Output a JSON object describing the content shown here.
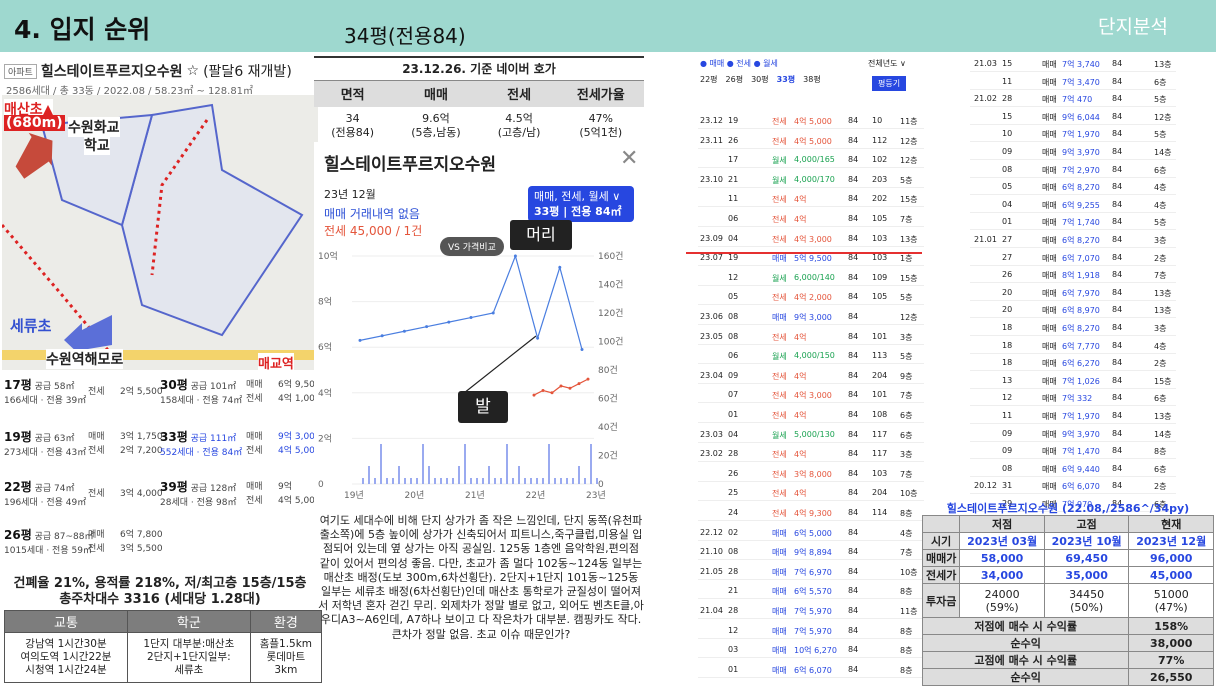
{
  "header": {
    "title": "4. 입지 순위",
    "subtitle": "34평(전용84)",
    "brand": "단지분석"
  },
  "p1": {
    "tag": "아파트",
    "name": "힐스테이트푸르지오수원",
    "star": "☆",
    "note": "(팔달6 재개발)",
    "sub": "2586세대 / 총 33동 / 2022.08 / 58.23㎡ ~ 128.81㎡",
    "map": {
      "maesan": "매산초▲",
      "maesan_dist": "(680m)",
      "school1": "수원화교",
      "school2": "학교",
      "seryu": "세류초",
      "road": "수원역해모로",
      "maegyo": "매교역"
    },
    "listings": [
      {
        "py": "17평",
        "a1": "공급 58㎡",
        "a2": "166세대 · 전용 39㎡",
        "t1": "전세",
        "v1": "2억 5,500"
      },
      {
        "py": "30평",
        "a1": "공급 101㎡",
        "a2": "158세대 · 전용 74㎡",
        "t1": "매매",
        "v1": "6억 9,500",
        "t2": "전세",
        "v2": "4억 1,000"
      },
      {
        "py": "19평",
        "a1": "공급 63㎡",
        "a2": "273세대 · 전용 43㎡",
        "t1": "매매",
        "v1": "3억 1,750",
        "t2": "전세",
        "v2": "2억 7,200"
      },
      {
        "py": "33평",
        "a1": "공급 111㎡",
        "a2": "552세대 · 전용 84㎡",
        "t1": "매매",
        "v1": "9억 3,000",
        "t2": "전세",
        "v2": "4억 5,000"
      },
      {
        "py": "22평",
        "a1": "공급 74㎡",
        "a2": "196세대 · 전용 49㎡",
        "t1": "전세",
        "v1": "3억 4,000"
      },
      {
        "py": "39평",
        "a1": "공급 128㎡",
        "a2": "28세대 · 전용 98㎡",
        "t1": "매매",
        "v1": "9억",
        "t2": "전세",
        "v2": "4억 5,000"
      },
      {
        "py": "26평",
        "a1": "공급 87~88㎡",
        "a2": "1015세대 · 전용 59㎡",
        "t1": "매매",
        "v1": "6억 7,800",
        "t2": "전세",
        "v2": "3억 5,500"
      }
    ],
    "stats1": "건폐율 21%, 용적률 218%, 저/최고층 15층/15층",
    "stats2": "총주차대수 3316 (세대당 1.28대)",
    "tbl": {
      "h": [
        "교통",
        "학군",
        "환경"
      ],
      "c1": "강남역 1시간30분\n여의도역 1시간22분\n시청역 1시간24분",
      "c2": "1단지 대부분:매산초\n2단지+1단지일부:\n세류초",
      "c3": "홈플1.5km\n롯데마트\n3km"
    }
  },
  "p2": {
    "tbl_title": "23.12.26. 기준 네이버 호가",
    "cols": [
      "면적",
      "매매",
      "전세",
      "전세가율"
    ],
    "row": [
      "34\n(전용84)",
      "9.6억\n(5층,남동)",
      "4.5억\n(고층/남)",
      "47%\n(5억1천)"
    ],
    "estate": "힐스테이트푸르지오수원",
    "month": "23년 12월",
    "trade": "매매 거래내역 없음",
    "rent": "전세 45,000 / 1건",
    "dd1": "매매, 전세, 월세 ∨",
    "dd2": "33평 | 전용 84㎡",
    "head": "머리",
    "foot": "발",
    "vs": "VS 가격비교",
    "desc": "여기도 세대수에 비해 단지 상가가 좀 작은 느낌인데, 단지 동쪽(유천파출소쪽)에 5층 높이에 상가가 신축되어서 피트니스,죽구클럽,미용실 입점되어 있는데 옆 상가는 아직 공실임. 125동 1층엔 음악학원,편의점 같이 있어서 편의성 좋음. 다만, 초교가 좀 멀다 102동~124동 일부는 매산초 배정(도보 300m,6차선횡단). 2단지+1단지 101동~125동 일부는 세류초 배정(6차선횡단)인데 매산초 통학로가 균질성이 떨어져서 저학년 혼자 걷긴 무리. 외제차가 정말 별로 없고, 외어도 벤츠E클,아우디A3~A6인데, A7하나 보이고 다 작은차가 대부분. 캠핑카도 작다. 큰차가 정말 없음. 초교 이슈 때문인가?"
  },
  "chart_data": {
    "type": "line",
    "x": [
      "19년",
      "20년",
      "21년",
      "22년",
      "23년"
    ],
    "ylabel_left": [
      "10억",
      "8억",
      "6억",
      "4억",
      "2억",
      "0"
    ],
    "ylabel_right": [
      "160건",
      "140건",
      "120건",
      "100건",
      "80건",
      "60건",
      "40건",
      "20건",
      "0"
    ],
    "series": [
      {
        "name": "매매",
        "values": [
          6.3,
          6.5,
          6.7,
          6.9,
          7.1,
          7.3,
          7.5,
          10,
          6.4,
          9.5,
          5.9
        ]
      },
      {
        "name": "전세",
        "values": [
          3.9,
          4.1,
          4.0,
          4.3,
          4.2,
          4.4,
          4.6
        ]
      }
    ]
  },
  "p3": {
    "legend": "● 매매  ● 전세  ● 월세",
    "year": "전체년도 ∨",
    "tabs": [
      "22평",
      "26평",
      "30평",
      "33평",
      "38평"
    ],
    "btn": "평등기",
    "rows": [
      [
        "23.12",
        "19",
        "전세",
        "4억 5,000",
        "84",
        "10",
        "11층"
      ],
      [
        "23.11",
        "26",
        "전세",
        "4억 5,000",
        "84",
        "112",
        "12층"
      ],
      [
        "",
        "17",
        "월세",
        "4,000/165",
        "84",
        "102",
        "12층"
      ],
      [
        "23.10",
        "21",
        "월세",
        "4,000/170",
        "84",
        "203",
        "5층"
      ],
      [
        "",
        "11",
        "전세",
        "4억",
        "84",
        "202",
        "15층"
      ],
      [
        "",
        "06",
        "전세",
        "4억",
        "84",
        "105",
        "7층"
      ],
      [
        "23.09",
        "04",
        "전세",
        "4억 3,000",
        "84",
        "103",
        "13층"
      ],
      [
        "23.07",
        "19",
        "매매",
        "5억 9,500",
        "84",
        "103",
        "1층"
      ],
      [
        "",
        "12",
        "월세",
        "6,000/140",
        "84",
        "109",
        "15층"
      ],
      [
        "",
        "05",
        "전세",
        "4억 2,000",
        "84",
        "105",
        "5층"
      ],
      [
        "23.06",
        "08",
        "매매",
        "9억 3,000",
        "84",
        "",
        "12층"
      ],
      [
        "23.05",
        "08",
        "전세",
        "4억",
        "84",
        "101",
        "3층"
      ],
      [
        "",
        "06",
        "월세",
        "4,000/150",
        "84",
        "113",
        "5층"
      ],
      [
        "23.04",
        "09",
        "전세",
        "4억",
        "84",
        "204",
        "9층"
      ],
      [
        "",
        "07",
        "전세",
        "4억 3,000",
        "84",
        "101",
        "7층"
      ],
      [
        "",
        "01",
        "전세",
        "4억",
        "84",
        "108",
        "6층"
      ],
      [
        "23.03",
        "04",
        "월세",
        "5,000/130",
        "84",
        "117",
        "6층"
      ],
      [
        "23.02",
        "28",
        "전세",
        "4억",
        "84",
        "117",
        "3층"
      ],
      [
        "",
        "26",
        "전세",
        "3억 8,000",
        "84",
        "103",
        "7층"
      ],
      [
        "",
        "25",
        "전세",
        "4억",
        "84",
        "204",
        "10층"
      ],
      [
        "",
        "24",
        "전세",
        "4억 9,300",
        "84",
        "114",
        "8층"
      ],
      [
        "22.12",
        "02",
        "매매",
        "6억 5,000",
        "84",
        "",
        "4층"
      ],
      [
        "21.10",
        "08",
        "매매",
        "9억 8,894",
        "84",
        "",
        "7층"
      ],
      [
        "21.05",
        "28",
        "매매",
        "7억 6,970",
        "84",
        "",
        "10층"
      ],
      [
        "",
        "21",
        "매매",
        "6억 5,570",
        "84",
        "",
        "8층"
      ],
      [
        "21.04",
        "28",
        "매매",
        "7억 5,970",
        "84",
        "",
        "11층"
      ],
      [
        "",
        "12",
        "매매",
        "7억 5,970",
        "84",
        "",
        "8층"
      ],
      [
        "",
        "03",
        "매매",
        "10억 6,270",
        "84",
        "",
        "8층"
      ],
      [
        "",
        "01",
        "매매",
        "6억 6,070",
        "84",
        "",
        "8층"
      ]
    ]
  },
  "p4": {
    "rows": [
      [
        "21.03",
        "15",
        "매매",
        "7억 3,740",
        "84",
        "13층"
      ],
      [
        "",
        "11",
        "매매",
        "7억 3,470",
        "84",
        "6층"
      ],
      [
        "21.02",
        "28",
        "매매",
        "7억 470",
        "84",
        "5층"
      ],
      [
        "",
        "15",
        "매매",
        "9억 6,044",
        "84",
        "12층"
      ],
      [
        "",
        "10",
        "매매",
        "7억 1,970",
        "84",
        "5층"
      ],
      [
        "",
        "09",
        "매매",
        "9억 3,970",
        "84",
        "14층"
      ],
      [
        "",
        "08",
        "매매",
        "7억 2,970",
        "84",
        "6층"
      ],
      [
        "",
        "05",
        "매매",
        "6억 8,270",
        "84",
        "4층"
      ],
      [
        "",
        "04",
        "매매",
        "6억 9,255",
        "84",
        "4층"
      ],
      [
        "",
        "01",
        "매매",
        "7억 1,740",
        "84",
        "5층"
      ],
      [
        "21.01",
        "27",
        "매매",
        "6억 8,270",
        "84",
        "3층"
      ],
      [
        "",
        "27",
        "매매",
        "6억 7,070",
        "84",
        "2층"
      ],
      [
        "",
        "26",
        "매매",
        "8억 1,918",
        "84",
        "7층"
      ],
      [
        "",
        "20",
        "매매",
        "6억 7,970",
        "84",
        "13층"
      ],
      [
        "",
        "20",
        "매매",
        "6억 8,970",
        "84",
        "13층"
      ],
      [
        "",
        "18",
        "매매",
        "6억 8,270",
        "84",
        "3층"
      ],
      [
        "",
        "18",
        "매매",
        "6억 7,770",
        "84",
        "4층"
      ],
      [
        "",
        "18",
        "매매",
        "6억 6,270",
        "84",
        "2층"
      ],
      [
        "",
        "13",
        "매매",
        "7억 1,026",
        "84",
        "15층"
      ],
      [
        "",
        "12",
        "매매",
        "7억 332",
        "84",
        "6층"
      ],
      [
        "",
        "11",
        "매매",
        "7억 1,970",
        "84",
        "13층"
      ],
      [
        "",
        "09",
        "매매",
        "9억 3,970",
        "84",
        "14층"
      ],
      [
        "",
        "09",
        "매매",
        "7억 1,470",
        "84",
        "8층"
      ],
      [
        "",
        "08",
        "매매",
        "6억 9,440",
        "84",
        "6층"
      ],
      [
        "20.12",
        "31",
        "매매",
        "6억 6,070",
        "84",
        "2층"
      ],
      [
        "",
        "29",
        "매매",
        "7억 970",
        "84",
        "6층"
      ]
    ],
    "tbl_title": "힐스테이트푸르지오수원 (22.08,/2586^/34py)",
    "tbl": {
      "h": [
        "",
        "저점",
        "고점",
        "현재"
      ],
      "r1": [
        "시기",
        "2023년 03월",
        "2023년 10월",
        "2023년 12월"
      ],
      "r2": [
        "매매가",
        "58,000",
        "69,450",
        "96,000"
      ],
      "r3": [
        "전세가",
        "34,000",
        "35,000",
        "45,000"
      ],
      "r4": [
        "투자금",
        "24000\n(59%)",
        "34450\n(50%)",
        "51000\n(47%)"
      ],
      "r5": [
        "저점에 매수 시 수익률",
        "158%"
      ],
      "r6": [
        "순수익",
        "38,000"
      ],
      "r7": [
        "고점에 매수 시 수익률",
        "77%"
      ],
      "r8": [
        "순수익",
        "26,550"
      ]
    }
  }
}
